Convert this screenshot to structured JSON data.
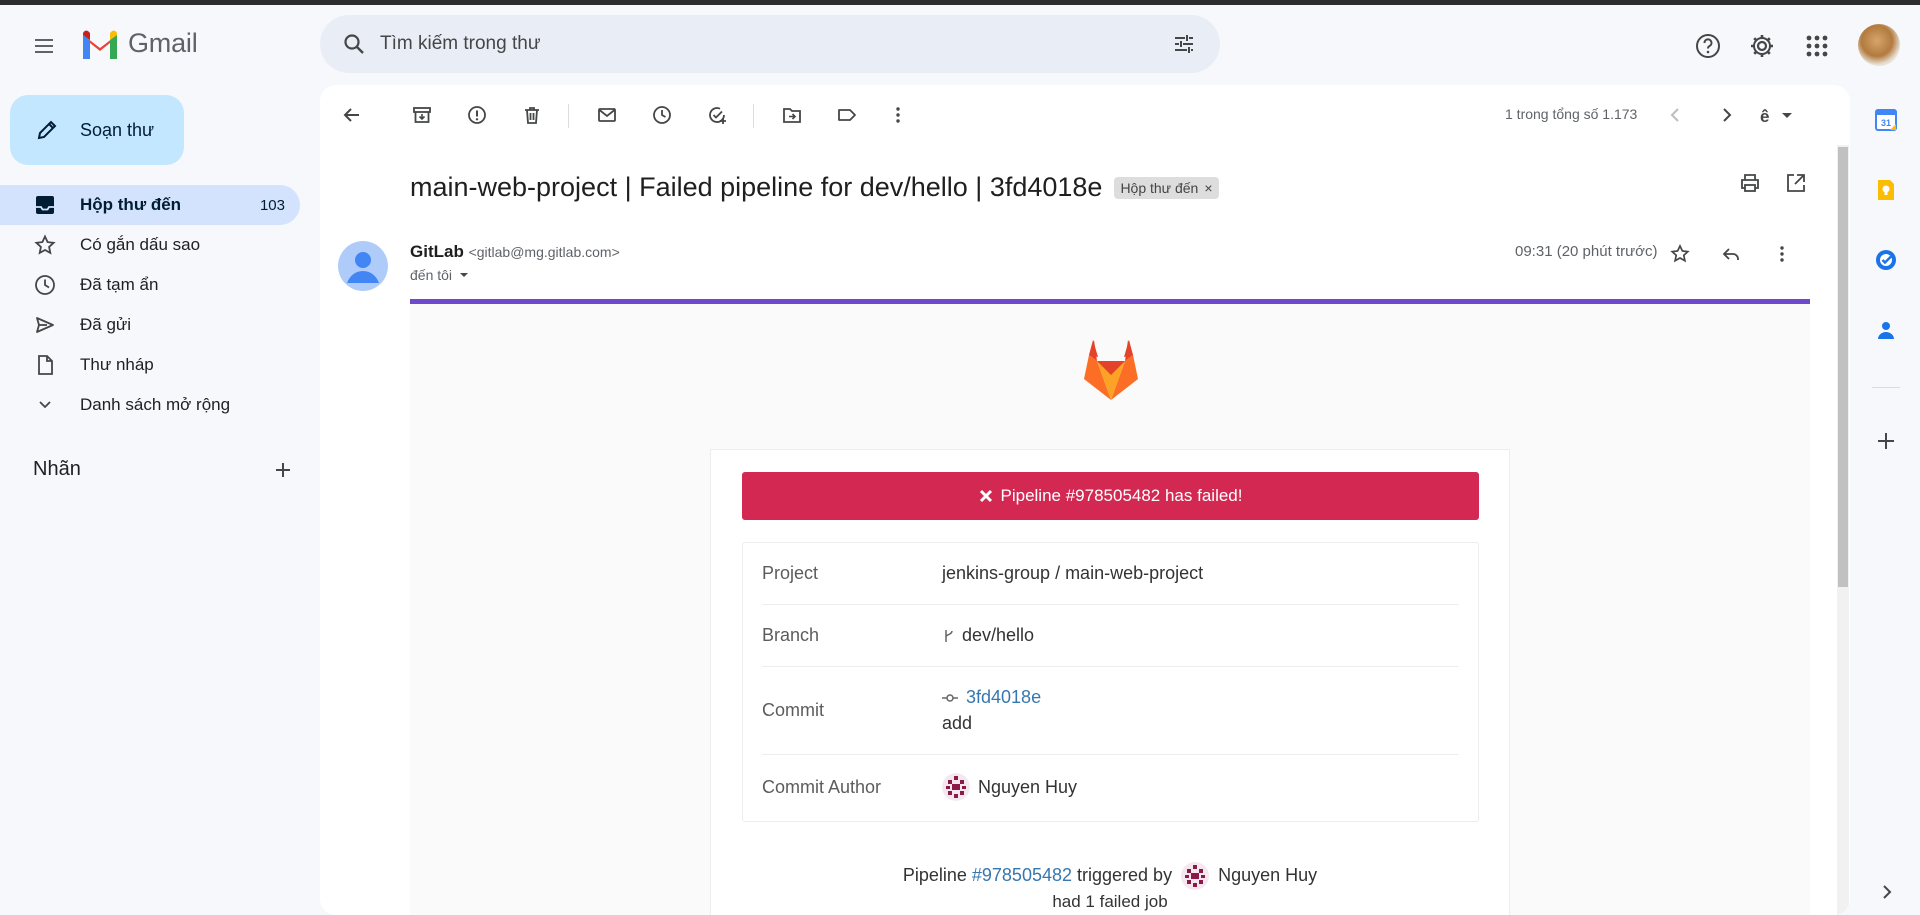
{
  "app": {
    "name": "Gmail"
  },
  "search": {
    "placeholder": "Tìm kiếm trong thư"
  },
  "compose": {
    "label": "Soạn thư"
  },
  "sidebar": {
    "items": [
      {
        "label": "Hộp thư đến",
        "count": "103",
        "icon": "inbox-icon",
        "active": true
      },
      {
        "label": "Có gắn dấu sao",
        "count": "",
        "icon": "star-icon"
      },
      {
        "label": "Đã tạm ẩn",
        "count": "",
        "icon": "clock-icon"
      },
      {
        "label": "Đã gửi",
        "count": "",
        "icon": "send-icon"
      },
      {
        "label": "Thư nháp",
        "count": "",
        "icon": "draft-icon"
      },
      {
        "label": "Danh sách mở rộng",
        "count": "",
        "icon": "chevron-down-icon"
      }
    ],
    "labels_title": "Nhãn"
  },
  "toolbar": {
    "pager": "1 trong tổng số 1.173"
  },
  "message": {
    "subject": "main-web-project | Failed pipeline for dev/hello | 3fd4018e",
    "tag": "Hộp thư đến",
    "sender_name": "GitLab",
    "sender_email": "<gitlab@mg.gitlab.com>",
    "to": "đến tôi",
    "time": "09:31 (20 phút trước)"
  },
  "email": {
    "banner": "Pipeline #978505482 has failed!",
    "rows": {
      "project_label": "Project",
      "project_value": "jenkins-group / main-web-project",
      "branch_label": "Branch",
      "branch_value": "dev/hello",
      "commit_label": "Commit",
      "commit_hash": "3fd4018e",
      "commit_message": "add",
      "author_label": "Commit Author",
      "author_value": "Nguyen Huy"
    },
    "footer": {
      "prefix": "Pipeline",
      "pipeline_link": "#978505482",
      "middle": "triggered by",
      "user": "Nguyen Huy",
      "line2": "had 1 failed job"
    }
  },
  "colors": {
    "banner_bg": "#d22852",
    "link": "#3777b0",
    "accent_bar": "#6e49cb",
    "active_nav": "#d3e3fd",
    "compose_bg": "#c2e7ff"
  }
}
